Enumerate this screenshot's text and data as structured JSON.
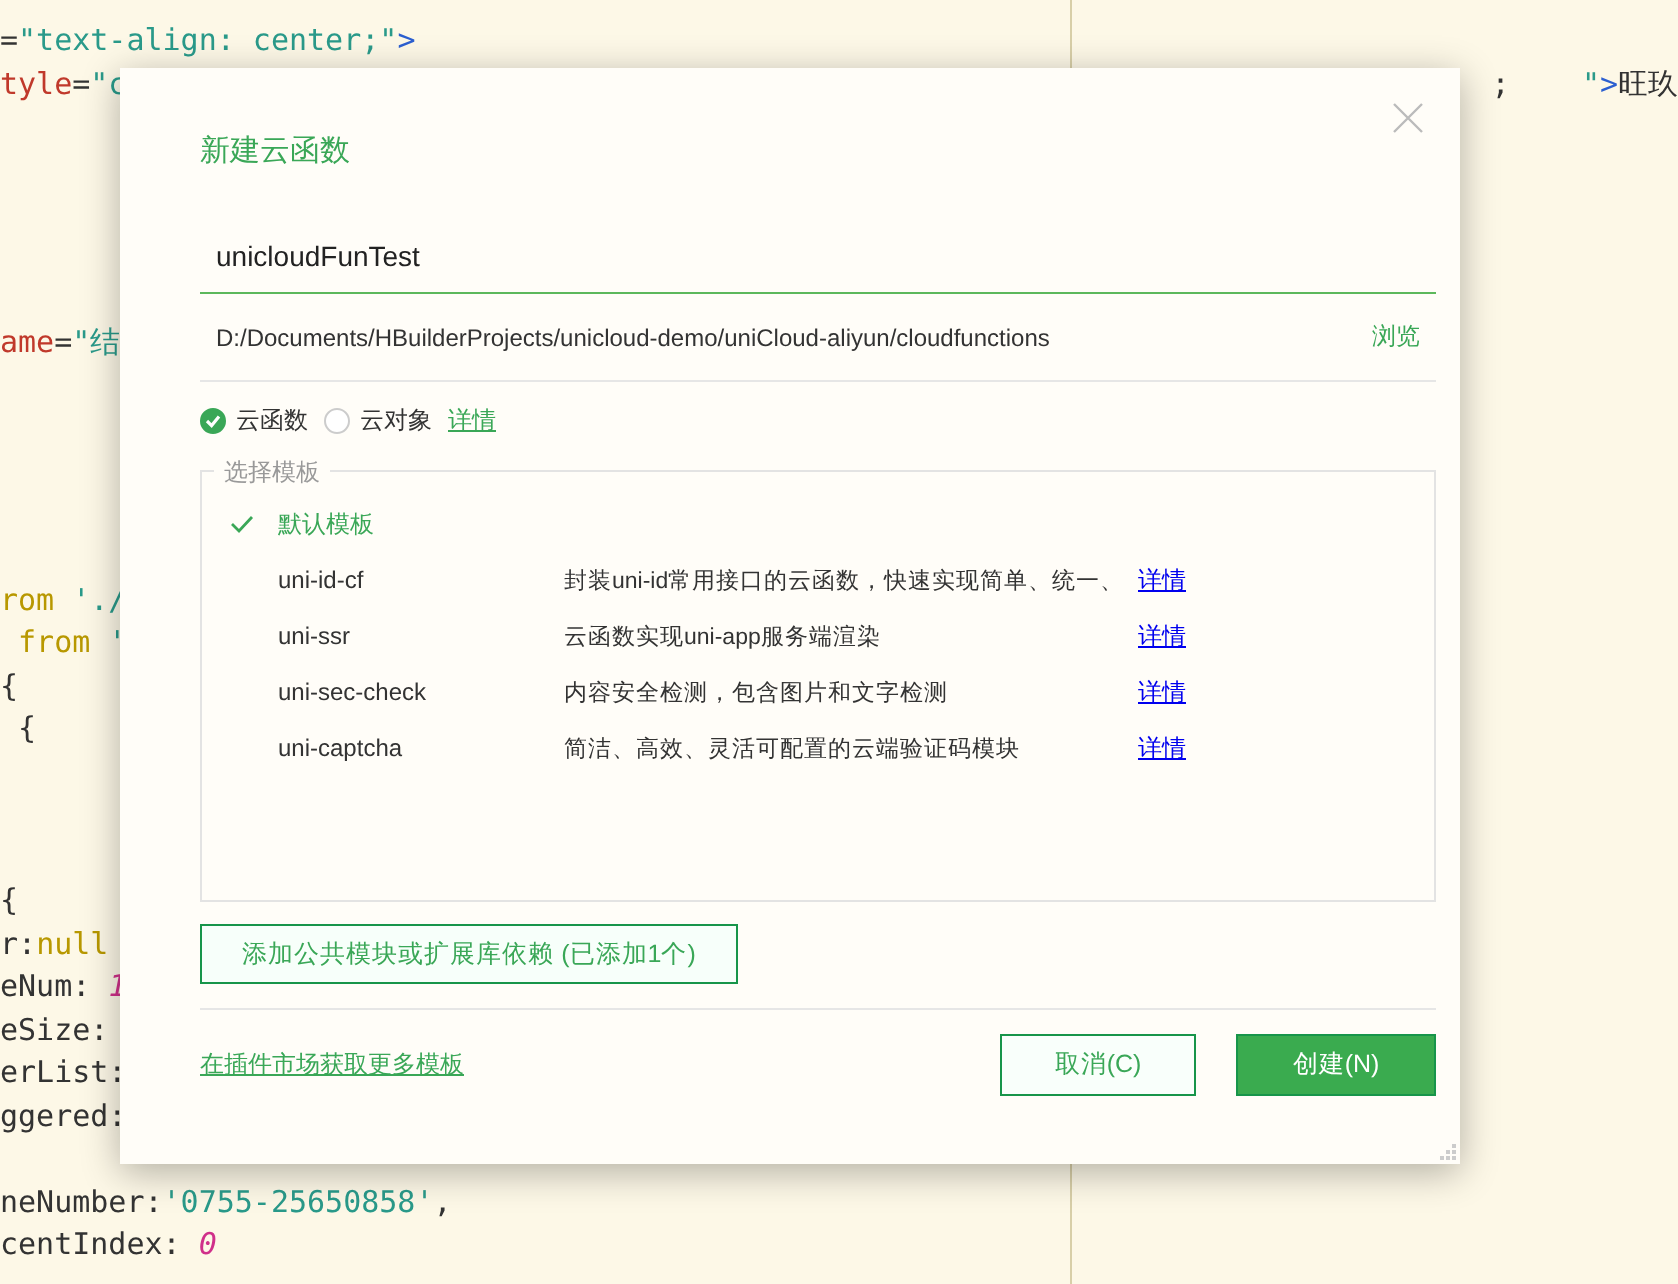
{
  "editor": {
    "left_lines": [
      {
        "kind": "code",
        "tokens": [
          {
            "text": "=",
            "kind": "punct"
          },
          {
            "text": "\"text-align: center;\"",
            "kind": "string"
          },
          {
            "text": ">",
            "kind": "tag"
          }
        ]
      },
      {
        "kind": "code",
        "tokens": [
          {
            "text": "tyle",
            "kind": "attr"
          },
          {
            "text": "=",
            "kind": "punct"
          },
          {
            "text": "\"c",
            "kind": "string"
          }
        ]
      },
      {
        "kind": "blank"
      },
      {
        "kind": "blank"
      },
      {
        "kind": "blank"
      },
      {
        "kind": "blank"
      },
      {
        "kind": "blank"
      },
      {
        "kind": "code",
        "tokens": [
          {
            "text": "ame",
            "kind": "attr"
          },
          {
            "text": "=",
            "kind": "punct"
          },
          {
            "text": "\"结",
            "kind": "string"
          }
        ]
      },
      {
        "kind": "blank"
      },
      {
        "kind": "blank"
      },
      {
        "kind": "blank"
      },
      {
        "kind": "blank"
      },
      {
        "kind": "blank"
      },
      {
        "kind": "code",
        "tokens": [
          {
            "text": "rom",
            "kind": "keyword"
          },
          {
            "text": " './",
            "kind": "string"
          }
        ]
      },
      {
        "kind": "code",
        "tokens": [
          {
            "text": " from",
            "kind": "keyword"
          },
          {
            "text": " '",
            "kind": "string"
          }
        ]
      },
      {
        "kind": "code",
        "tokens": [
          {
            "text": "{",
            "kind": "punct"
          }
        ]
      },
      {
        "kind": "code",
        "tokens": [
          {
            "text": " {",
            "kind": "punct"
          }
        ]
      },
      {
        "kind": "blank"
      },
      {
        "kind": "blank"
      },
      {
        "kind": "blank"
      },
      {
        "kind": "code",
        "tokens": [
          {
            "text": "{",
            "kind": "punct"
          }
        ]
      },
      {
        "kind": "code",
        "tokens": [
          {
            "text": "r:",
            "kind": "punct"
          },
          {
            "text": "null",
            "kind": "keyword"
          }
        ]
      },
      {
        "kind": "code",
        "tokens": [
          {
            "text": "eNum: ",
            "kind": "punct"
          },
          {
            "text": "1",
            "kind": "number"
          }
        ]
      },
      {
        "kind": "code",
        "tokens": [
          {
            "text": "eSize:",
            "kind": "punct"
          }
        ]
      },
      {
        "kind": "code",
        "tokens": [
          {
            "text": "erList:",
            "kind": "punct"
          }
        ]
      },
      {
        "kind": "code",
        "tokens": [
          {
            "text": "ggered:",
            "kind": "punct"
          }
        ]
      },
      {
        "kind": "blank"
      },
      {
        "kind": "code",
        "tokens": [
          {
            "text": "neNumber:",
            "kind": "punct"
          },
          {
            "text": "'0755-25650858'",
            "kind": "string"
          },
          {
            "text": ",",
            "kind": "punct"
          }
        ]
      },
      {
        "kind": "code",
        "tokens": [
          {
            "text": "centIndex: ",
            "kind": "punct"
          },
          {
            "text": "0",
            "kind": "number"
          }
        ]
      }
    ],
    "right_lines": [
      {
        "kind": "blank"
      },
      {
        "kind": "code",
        "tokens": [
          {
            "text": ";    ",
            "kind": "punct"
          },
          {
            "text": "\"",
            "kind": "string"
          },
          {
            "text": ">",
            "kind": "tag"
          },
          {
            "text": "旺玖",
            "kind": "punct"
          }
        ]
      }
    ]
  },
  "dialog": {
    "title": "新建云函数",
    "name_field": {
      "value": "unicloudFunTest"
    },
    "path": {
      "value": "D:/Documents/HBuilderProjects/unicloud-demo/uniCloud-aliyun/cloudfunctions",
      "browse": "浏览"
    },
    "types": [
      {
        "label": "云函数",
        "selected": true
      },
      {
        "label": "云对象",
        "selected": false
      }
    ],
    "types_link": "详情",
    "templates": {
      "legend": "选择模板",
      "items": [
        {
          "name": "默认模板",
          "selected": true
        },
        {
          "name": "uni-id-cf",
          "description": "封装uni-id常用接口的云函数，快速实现简单、统一、",
          "link": "详情",
          "selected": false
        },
        {
          "name": "uni-ssr",
          "description": "云函数实现uni-app服务端渲染",
          "link": "详情",
          "selected": false
        },
        {
          "name": "uni-sec-check",
          "description": "内容安全检测，包含图片和文字检测",
          "link": "详情",
          "selected": false
        },
        {
          "name": "uni-captcha",
          "description": "简洁、高效、灵活可配置的云端验证码模块",
          "link": "详情",
          "selected": false
        }
      ]
    },
    "add_dependency": "添加公共模块或扩展库依赖 (已添加1个)",
    "market_link": "在插件市场获取更多模板",
    "buttons": [
      {
        "label": "取消(C)",
        "kind": "secondary"
      },
      {
        "label": "创建(N)",
        "kind": "primary"
      }
    ]
  }
}
